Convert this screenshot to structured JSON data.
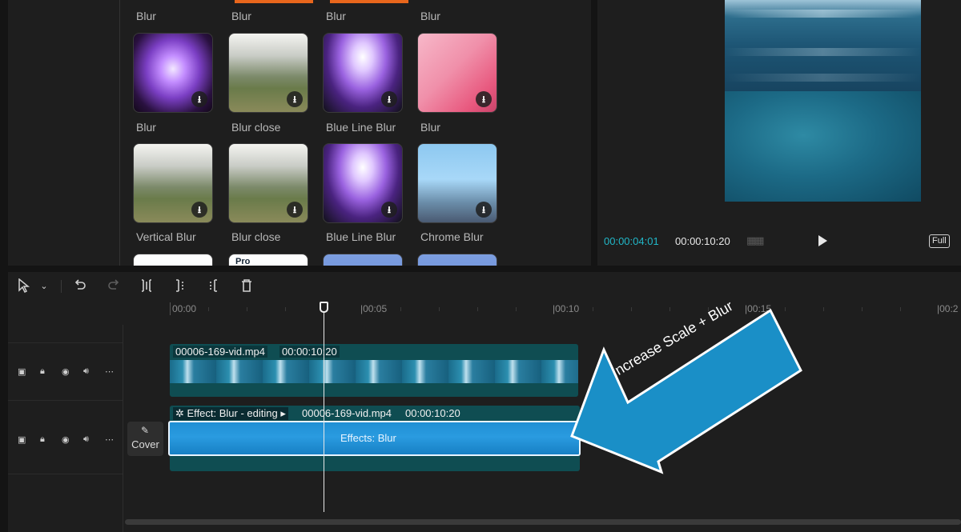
{
  "effects": {
    "top_row_labels": [
      "Blur",
      "Blur",
      "Blur",
      "Blur"
    ],
    "cards": [
      {
        "label": "Blur",
        "thumb": "purple-lights"
      },
      {
        "label": "Blur close",
        "thumb": "forest-deer"
      },
      {
        "label": "Blue Line Blur",
        "thumb": "concert-crowd"
      },
      {
        "label": "Blur",
        "thumb": "pink-portrait"
      },
      {
        "label": "Vertical Blur",
        "thumb": "forest-deer"
      },
      {
        "label": "Blur close",
        "thumb": "forest-deer"
      },
      {
        "label": "Blue Line Blur",
        "thumb": "concert-crowd"
      },
      {
        "label": "Chrome Blur",
        "thumb": "chrome-person"
      }
    ],
    "pro_badge": "Pro",
    "download_icon": "download-icon"
  },
  "player": {
    "current_time": "00:00:04:01",
    "total_time": "00:00:10:20",
    "full_label": "Full",
    "play_icon": "play-icon"
  },
  "toolbar": {
    "icons": [
      "select-pointer-icon",
      "chevron-down-icon",
      "undo-icon",
      "redo-icon",
      "split-icon",
      "split-left-icon",
      "split-right-icon",
      "delete-icon"
    ]
  },
  "ruler": {
    "labels": [
      "00:00",
      "|00:05",
      "|00:10",
      "|00:15",
      "|00:2"
    ]
  },
  "tracks": {
    "video_clip": {
      "file": "00006-169-vid.mp4",
      "duration": "00:00:10:20"
    },
    "effect_clip": {
      "tag": "Effect: Blur - editing",
      "file": "00006-169-vid.mp4",
      "duration": "00:00:10:20",
      "center_label": "Effects:  Blur"
    },
    "cover_label": "Cover"
  },
  "annotation": {
    "text": "Increase Scale + Blur",
    "arrow_color": "#1a8fc7"
  }
}
